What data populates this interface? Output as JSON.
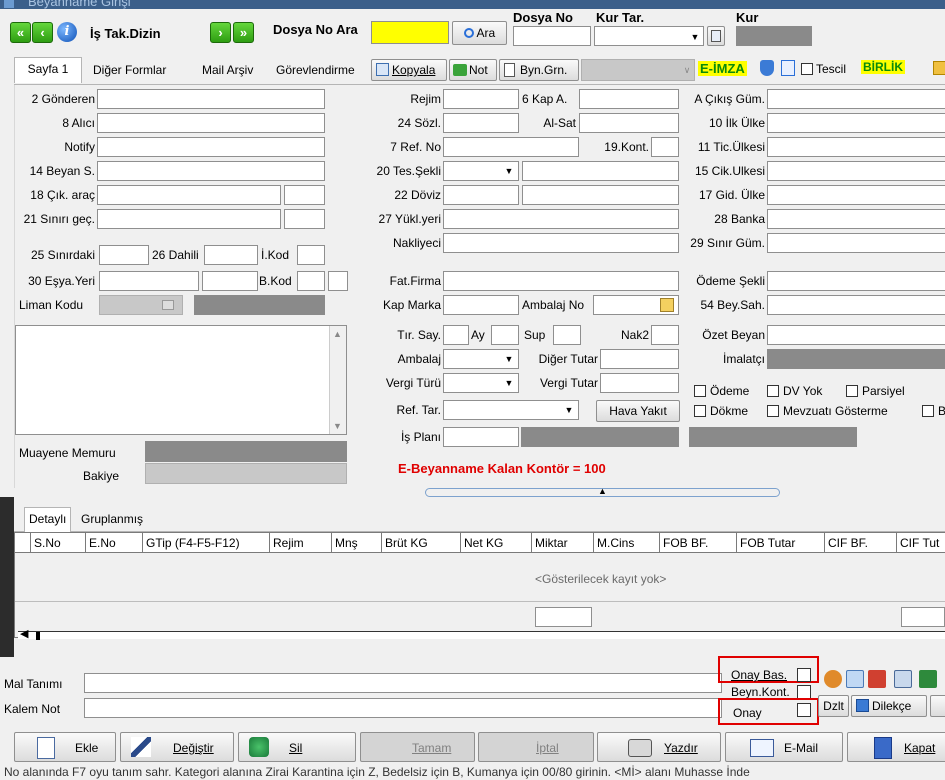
{
  "titlebar": {
    "ghost_text": "Beyanname Girişi"
  },
  "toolbar": {
    "first_label": "«",
    "prev_label": "‹",
    "info_label": "i",
    "is_tak_dizin": "İş Tak.Dizin",
    "next_label": "›",
    "last_label": "»",
    "dosya_no_ara_label": "Dosya No Ara",
    "dosya_no_ara_value": "",
    "ara_button": "Ara",
    "dosya_no_label": "Dosya No",
    "kur_tar_label": "Kur Tar.",
    "kur_label": "Kur"
  },
  "tabs": [
    {
      "label": "Sayfa 1"
    },
    {
      "label": "Diğer Formlar"
    },
    {
      "label": "Mail Arşiv"
    },
    {
      "label": "Görevlendirme"
    }
  ],
  "tabstrip_buttons": {
    "kopyala": "Kopyala",
    "not": "Not",
    "byn_grn": "Byn.Grn.",
    "e_imza": "E-İMZA",
    "tescil": "Tescil",
    "birlik": "BİRLİK"
  },
  "form": {
    "col1": {
      "gonderen": "2 Gönderen",
      "alici": "8 Alıcı",
      "notify": "Notify",
      "beyan_s": "14 Beyan S.",
      "cik_arac": "18 Çık. araç",
      "sinir_gec": "21 Sınırı geç.",
      "sinirdaki": "25 Sınırdaki",
      "dahili": "26 Dahili",
      "i_kod": "İ.Kod",
      "esya_yeri": "30 Eşya.Yeri",
      "b_kod": "B.Kod",
      "liman_kodu": "Liman Kodu",
      "muayene_memuru": "Muayene Memuru",
      "bakiye": "Bakiye"
    },
    "col2": {
      "rejim": "Rejim",
      "kap_a": "6 Kap A.",
      "sozl": "24 Sözl.",
      "al_sat": "Al-Sat",
      "ref_no": "7 Ref. No",
      "kont": "19.Kont.",
      "tes_sekli": "20 Tes.Şekli",
      "doviz": "22 Döviz",
      "yukl_yeri": "27 Yükl.yeri",
      "nakliyeci": "Nakliyeci",
      "fat_firma": "Fat.Firma",
      "kap_marka": "Kap Marka",
      "ambalaj_no": "Ambalaj No",
      "tir_say": "Tır. Say.",
      "ay": "Ay",
      "sup": "Sup",
      "nak2": "Nak2",
      "ambalaj": "Ambalaj",
      "diger_tutar": "Diğer Tutar",
      "vergi_turu": "Vergi Türü",
      "vergi_tutar": "Vergi Tutar",
      "ref_tar": "Ref. Tar.",
      "hava_yakit": "Hava Yakıt",
      "is_plani": "İş Planı"
    },
    "col3": {
      "cikis_gum": "A Çıkış Güm.",
      "ilk_ulke": "10 İlk Ülke",
      "tic_ulkesi": "11 Tic.Ülkesi",
      "cik_ulkesi": "15 Cik.Ulkesi",
      "gid_ulke": "17 Gid. Ülke",
      "banka": "28 Banka",
      "sinir_gum": "29 Sınır Güm.",
      "odeme_sekli": "Ödeme Şekli",
      "bey_sah": "54 Bey.Sah.",
      "ozet_beyan": "Özet Beyan",
      "imalatci": "İmalatçı",
      "odeme": "Ödeme",
      "dv_yok": "DV Yok",
      "parsiyel": "Parsiyel",
      "dokme": "Dökme",
      "mevzuati": "Mevzuatı Gösterme",
      "b_trunc": "B"
    },
    "kontor_text": "E-Beyanname Kalan Kontör = 100"
  },
  "subtabs": [
    {
      "label": "Detaylı"
    },
    {
      "label": "Gruplanmış"
    }
  ],
  "grid": {
    "columns": [
      "S.No",
      "E.No",
      "GTip (F4-F5-F12)",
      "Rejim",
      "Mnş",
      "Brüt KG",
      "Net KG",
      "Miktar",
      "M.Cins",
      "FOB BF.",
      "FOB Tutar",
      "CIF BF.",
      "CIF Tut"
    ],
    "empty_text": "<Gösterilecek kayıt yok>"
  },
  "bottom": {
    "mal_tanimi": "Mal Tanımı",
    "kalem_not": "Kalem Not",
    "onay_bas": "Onay Bas.",
    "beyn_kont": "Beyn.Kont.",
    "onay": "Onay",
    "dzlt": "Dzlt",
    "dilekce": "Dilekçe"
  },
  "actions": {
    "ekle": "Ekle",
    "degistir": "Değiştir",
    "sil": "Sil",
    "tamam": "Tamam",
    "iptal": "İptal",
    "yazdir": "Yazdır",
    "email": "E-Mail",
    "kapat": "Kapat"
  },
  "status_text": "No alanında F7 oyu tanım sahr. Kategori alanına Zirai Karantina için Z, Bedelsiz için B, Kumanya için 00/80 girinin. <Mİ> alanı Muhasse İnde"
}
